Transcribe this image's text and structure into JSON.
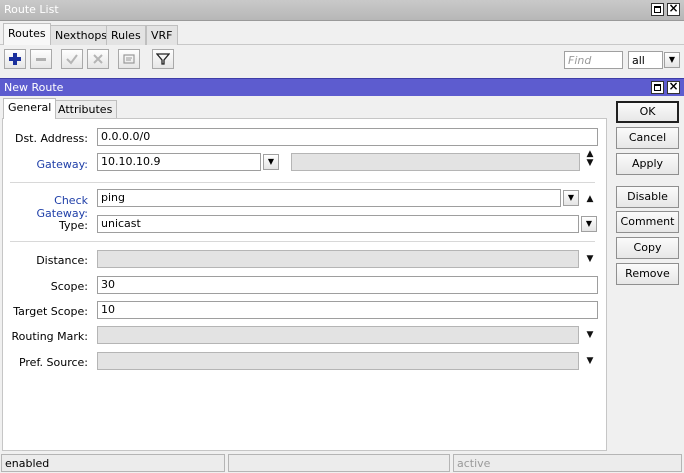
{
  "route_list": {
    "title": "Route List",
    "tabs": [
      "Routes",
      "Nexthops",
      "Rules",
      "VRF"
    ],
    "find_placeholder": "Find",
    "filter_value": "all"
  },
  "new_route": {
    "title": "New Route",
    "tabs": [
      "General",
      "Attributes"
    ],
    "fields": {
      "dst_address": {
        "label": "Dst. Address:",
        "value": "0.0.0.0/0"
      },
      "gateway": {
        "label": "Gateway:",
        "value": "10.10.10.9"
      },
      "check_gateway": {
        "label": "Check Gateway:",
        "value": "ping"
      },
      "type": {
        "label": "Type:",
        "value": "unicast"
      },
      "distance": {
        "label": "Distance:",
        "value": ""
      },
      "scope": {
        "label": "Scope:",
        "value": "30"
      },
      "target_scope": {
        "label": "Target Scope:",
        "value": "10"
      },
      "routing_mark": {
        "label": "Routing Mark:",
        "value": ""
      },
      "pref_source": {
        "label": "Pref. Source:",
        "value": ""
      }
    },
    "buttons": {
      "ok": "OK",
      "cancel": "Cancel",
      "apply": "Apply",
      "disable": "Disable",
      "comment": "Comment",
      "copy": "Copy",
      "remove": "Remove"
    },
    "status": {
      "left": "enabled",
      "right": "active"
    }
  },
  "colors": {
    "title_active": "#5d5ccf",
    "title_inactive": "#bebebe",
    "label_link": "#1f3fa8"
  }
}
